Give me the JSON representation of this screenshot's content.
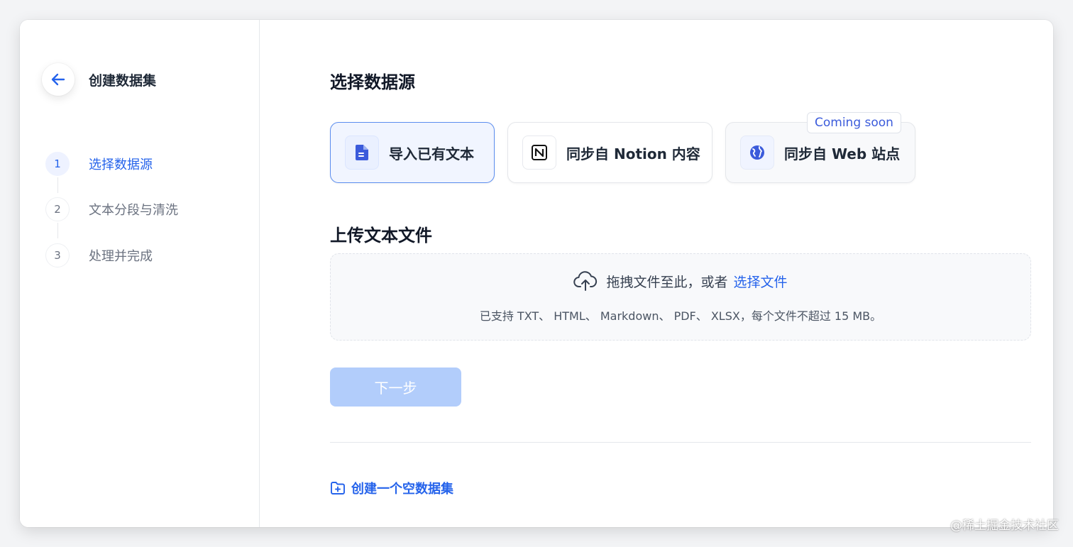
{
  "sidebar": {
    "title": "创建数据集",
    "steps": [
      {
        "num": "1",
        "label": "选择数据源",
        "active": true
      },
      {
        "num": "2",
        "label": "文本分段与清洗",
        "active": false
      },
      {
        "num": "3",
        "label": "处理并完成",
        "active": false
      }
    ]
  },
  "main": {
    "title": "选择数据源",
    "sources": [
      {
        "label": "导入已有文本",
        "icon": "file-icon",
        "selected": true
      },
      {
        "label": "同步自 Notion 内容",
        "icon": "notion-icon"
      },
      {
        "label": "同步自 Web 站点",
        "icon": "globe-icon",
        "badge": "Coming soon"
      }
    ],
    "upload_title": "上传文本文件",
    "dropzone": {
      "text": "拖拽文件至此，或者",
      "link": "选择文件",
      "hint": "已支持 TXT、 HTML、 Markdown、 PDF、 XLSX，每个文件不超过 15 MB。"
    },
    "next_button": "下一步",
    "empty_dataset": "创建一个空数据集"
  },
  "watermark": "@稀土掘金技术社区",
  "colors": {
    "accent": "#2563eb",
    "selected_card_bg": "#f1f5ff",
    "disabled_button": "#b2cdfb"
  }
}
